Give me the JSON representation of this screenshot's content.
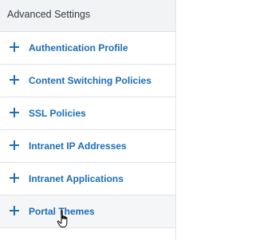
{
  "panel": {
    "title": "Advanced Settings",
    "items": [
      {
        "label": "Authentication Profile"
      },
      {
        "label": "Content Switching Policies"
      },
      {
        "label": "SSL Policies"
      },
      {
        "label": "Intranet IP Addresses"
      },
      {
        "label": "Intranet Applications"
      },
      {
        "label": "Portal Themes"
      }
    ]
  },
  "icons": {
    "add": "plus-icon",
    "cursor": "hand-pointer-icon"
  },
  "colors": {
    "accent": "#1b6db6",
    "header_bg": "#f1f3f5",
    "hover_bg": "#f5f6f8"
  }
}
